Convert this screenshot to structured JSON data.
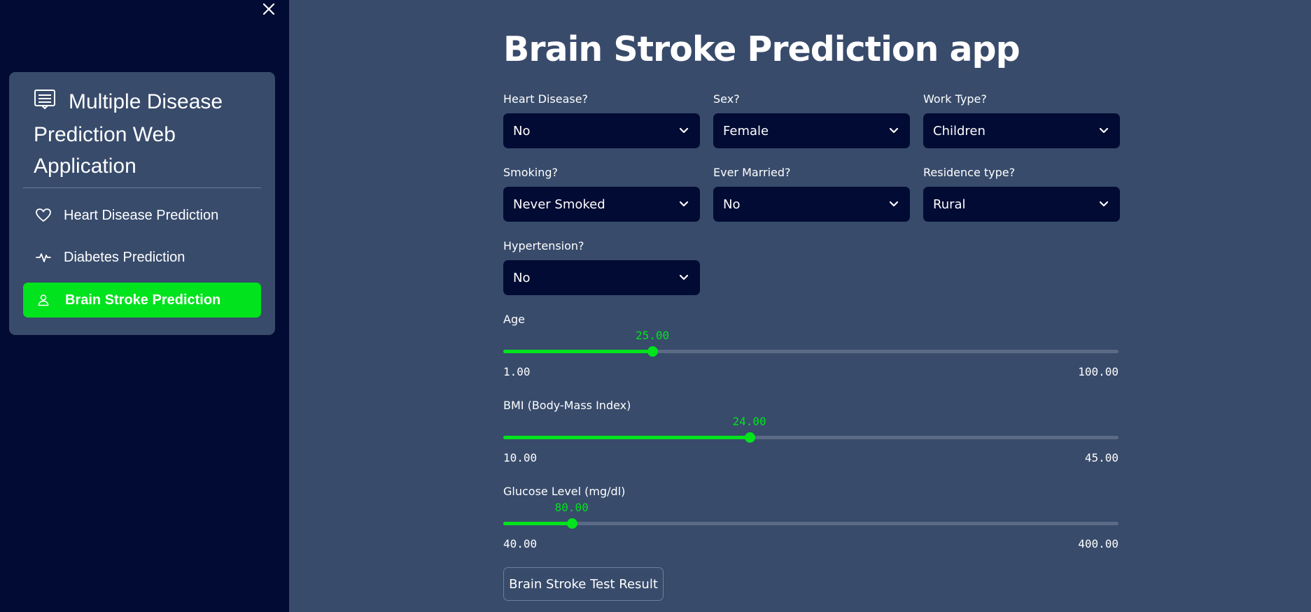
{
  "sidebar": {
    "close_icon": "close-icon",
    "menu_title": "Multiple Disease Prediction Web Application",
    "menu_title_icon": "list-icon",
    "items": [
      {
        "label": "Heart Disease Prediction",
        "icon": "heart-icon",
        "active": false
      },
      {
        "label": "Diabetes Prediction",
        "icon": "activity-icon",
        "active": false
      },
      {
        "label": "Brain Stroke Prediction",
        "icon": "person-icon",
        "active": true
      }
    ]
  },
  "main": {
    "title": "Brain Stroke Prediction app",
    "selects": {
      "heart_disease": {
        "label": "Heart Disease?",
        "value": "No"
      },
      "sex": {
        "label": "Sex?",
        "value": "Female"
      },
      "work_type": {
        "label": "Work Type?",
        "value": "Children"
      },
      "smoking": {
        "label": "Smoking?",
        "value": "Never Smoked"
      },
      "ever_married": {
        "label": "Ever Married?",
        "value": "No"
      },
      "residence_type": {
        "label": "Residence type?",
        "value": "Rural"
      },
      "hypertension": {
        "label": "Hypertension?",
        "value": "No"
      }
    },
    "sliders": {
      "age": {
        "label": "Age",
        "value": 25,
        "value_text": "25.00",
        "min": 1,
        "min_text": "1.00",
        "max": 100,
        "max_text": "100.00"
      },
      "bmi": {
        "label": "BMI (Body-Mass Index)",
        "value": 24,
        "value_text": "24.00",
        "min": 10,
        "min_text": "10.00",
        "max": 45,
        "max_text": "45.00"
      },
      "glucose": {
        "label": "Glucose Level (mg/dl)",
        "value": 80,
        "value_text": "80.00",
        "min": 40,
        "min_text": "40.00",
        "max": 400,
        "max_text": "400.00"
      }
    },
    "submit_label": "Brain Stroke Test Result"
  },
  "colors": {
    "accent": "#00e31d",
    "sidebar_bg": "#020b33",
    "main_bg": "#384b6b",
    "select_bg": "#020b33"
  }
}
